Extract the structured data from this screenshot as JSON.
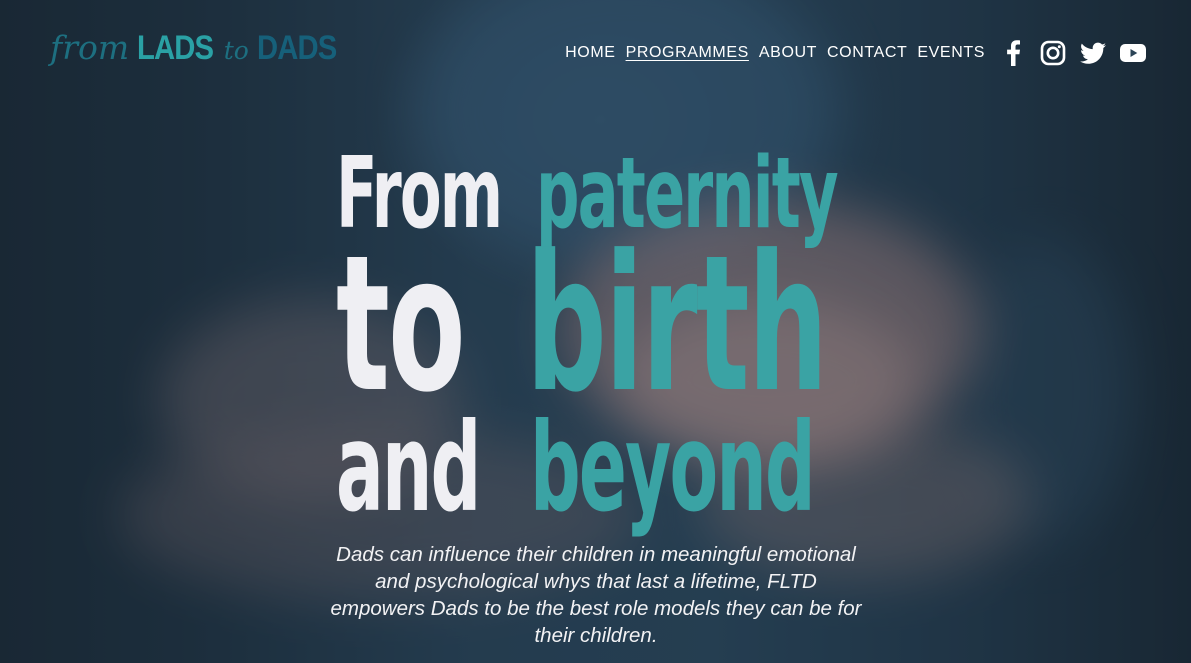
{
  "brand": {
    "logo_part1": "from",
    "logo_part2": "LADS",
    "logo_part3": "to",
    "logo_part4": "DADS"
  },
  "nav": {
    "items": [
      {
        "label": "HOME",
        "active": false
      },
      {
        "label": "PROGRAMMES",
        "active": true
      },
      {
        "label": "ABOUT",
        "active": false
      },
      {
        "label": "CONTACT",
        "active": false
      },
      {
        "label": "EVENTS",
        "active": false
      }
    ]
  },
  "social": {
    "icons": [
      "facebook-icon",
      "instagram-icon",
      "twitter-icon",
      "youtube-icon"
    ]
  },
  "hero": {
    "line1_white": "From",
    "line1_teal": "paternity",
    "line2_white": "to",
    "line2_teal": "birth",
    "line3_white": "and",
    "line3_teal": "beyond",
    "tagline": "Dads can influence their children in meaningful emotional and psychological whys that last a lifetime, FLTD empowers Dads to be the best role models they can be for their children."
  },
  "colors": {
    "accent_teal": "#3aa3a4",
    "logo_dark_teal": "#16607a",
    "headline_white": "#efeff3"
  }
}
